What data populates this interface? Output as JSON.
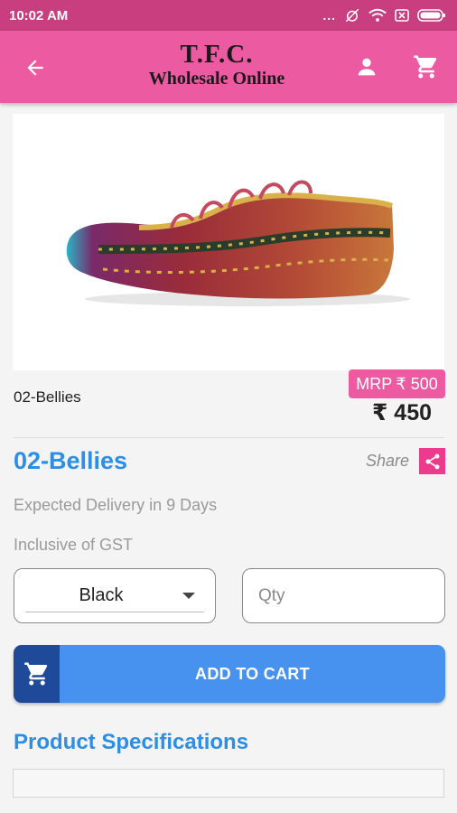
{
  "status_bar": {
    "time": "10:02 AM",
    "dots": "...",
    "icons": [
      "alarm-off-icon",
      "wifi-icon",
      "sim-off-icon",
      "battery-icon"
    ]
  },
  "header": {
    "brand_title": "T.F.C.",
    "brand_subtitle": "Wholesale Online",
    "icons": [
      "back-arrow-icon",
      "user-icon",
      "cart-icon"
    ],
    "color": "#ec5ba2"
  },
  "product": {
    "variant_name": "02-Bellies",
    "mrp_label": "MRP",
    "mrp_value": "₹ 500",
    "price": "₹ 450",
    "title": "02-Bellies",
    "share_label": "Share",
    "delivery": "Expected Delivery in 9 Days",
    "gst": "Inclusive of GST"
  },
  "form": {
    "color_selected": "Black",
    "qty_placeholder": "Qty"
  },
  "actions": {
    "add_to_cart": "ADD TO CART"
  },
  "sections": {
    "specifications_title": "Product Specifications"
  },
  "colors": {
    "status_bar": "#c83e7f",
    "accent_pink": "#ec5ba2",
    "title_blue": "#2d8ee6",
    "button_blue": "#4892ef",
    "button_dark": "#1e4a99"
  }
}
